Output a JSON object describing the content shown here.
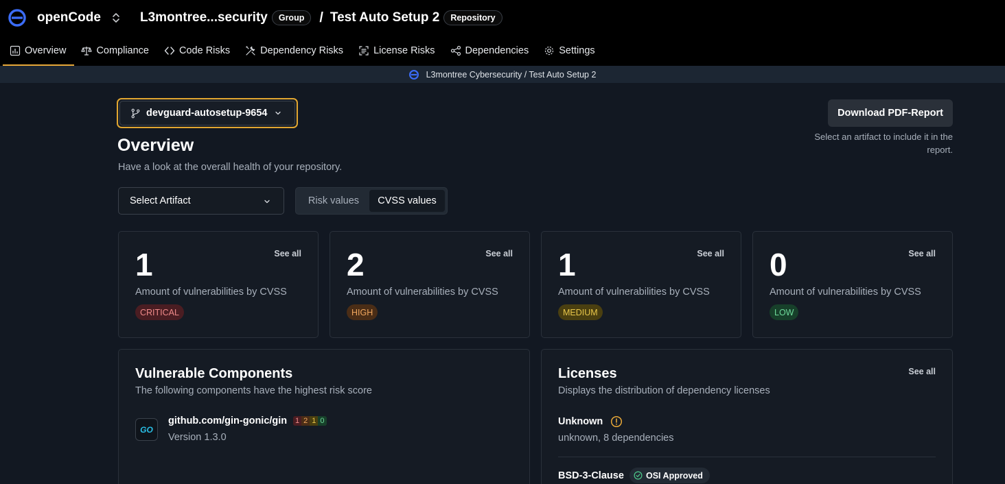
{
  "app": {
    "name": "openCode",
    "group_name": "L3montree...security",
    "group_badge": "Group",
    "separator": "/",
    "repo_name": "Test Auto Setup 2",
    "repo_badge": "Repository"
  },
  "nav": {
    "tabs": [
      {
        "label": "Overview",
        "icon": "chart-icon",
        "active": true
      },
      {
        "label": "Compliance",
        "icon": "scale-icon"
      },
      {
        "label": "Code Risks",
        "icon": "code-icon"
      },
      {
        "label": "Dependency Risks",
        "icon": "tools-icon"
      },
      {
        "label": "License Risks",
        "icon": "document-scan-icon"
      },
      {
        "label": "Dependencies",
        "icon": "share-nodes-icon"
      },
      {
        "label": "Settings",
        "icon": "gear-icon"
      }
    ]
  },
  "context_bar": {
    "text": "L3montree Cybersecurity / Test Auto Setup 2"
  },
  "branch_selector": {
    "value": "devguard-autosetup-9654"
  },
  "report": {
    "button_label": "Download PDF-Report",
    "hint": "Select an artifact to include it in the report."
  },
  "header": {
    "title": "Overview",
    "subtitle": "Have a look at the overall health of your repository."
  },
  "filters": {
    "artifact_placeholder": "Select Artifact",
    "toggle": {
      "option_a": "Risk values",
      "option_b": "CVSS values",
      "selected": "CVSS values"
    }
  },
  "stats": [
    {
      "count": "1",
      "see_all": "See all",
      "label": "Amount of vulnerabilities by CVSS",
      "severity": "CRITICAL"
    },
    {
      "count": "2",
      "see_all": "See all",
      "label": "Amount of vulnerabilities by CVSS",
      "severity": "HIGH"
    },
    {
      "count": "1",
      "see_all": "See all",
      "label": "Amount of vulnerabilities by CVSS",
      "severity": "MEDIUM"
    },
    {
      "count": "0",
      "see_all": "See all",
      "label": "Amount of vulnerabilities by CVSS",
      "severity": "LOW"
    }
  ],
  "vulnerable_components": {
    "title": "Vulnerable Components",
    "subtitle": "The following components have the highest risk score",
    "items": [
      {
        "icon_text": "GO",
        "name": "github.com/gin-gonic/gin",
        "version": "Version 1.3.0",
        "counts": {
          "critical": "1",
          "high": "2",
          "medium": "1",
          "low": "0"
        }
      }
    ]
  },
  "licenses": {
    "title": "Licenses",
    "see_all": "See all",
    "subtitle": "Displays the distribution of dependency licenses",
    "items": [
      {
        "name": "Unknown",
        "meta": "unknown, 8 dependencies",
        "warning": true
      },
      {
        "name": "BSD-3-Clause",
        "badge": "OSI Approved"
      }
    ]
  },
  "colors": {
    "accent": "#e2a630",
    "brand_blue": "#3b6cf6",
    "critical": "#f08a8a",
    "high": "#f1a75e",
    "medium": "#e8c64a",
    "low": "#6ed99a"
  }
}
